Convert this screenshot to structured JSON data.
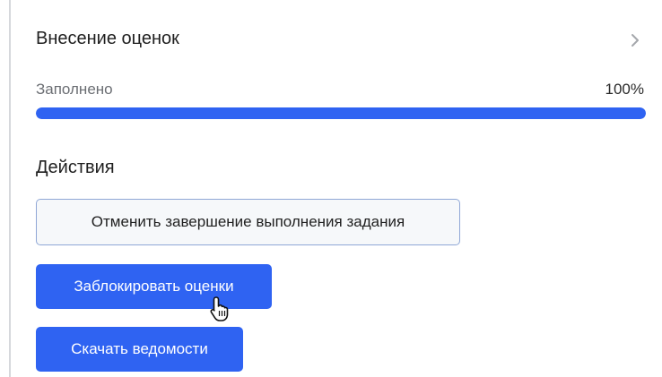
{
  "panel": {
    "title": "Внесение оценок"
  },
  "progress": {
    "label": "Заполнено",
    "value_text": "100%",
    "value": 100
  },
  "actions": {
    "title": "Действия",
    "cancel_completion_label": "Отменить завершение выполнения задания",
    "lock_grades_label": "Заблокировать оценки",
    "download_sheets_label": "Скачать ведомости"
  },
  "icons": {
    "chevron": "chevron-right-icon",
    "cursor": "hand-pointer-cursor-icon"
  },
  "colors": {
    "accent": "#2f63f2",
    "track": "#e3e6ea"
  }
}
